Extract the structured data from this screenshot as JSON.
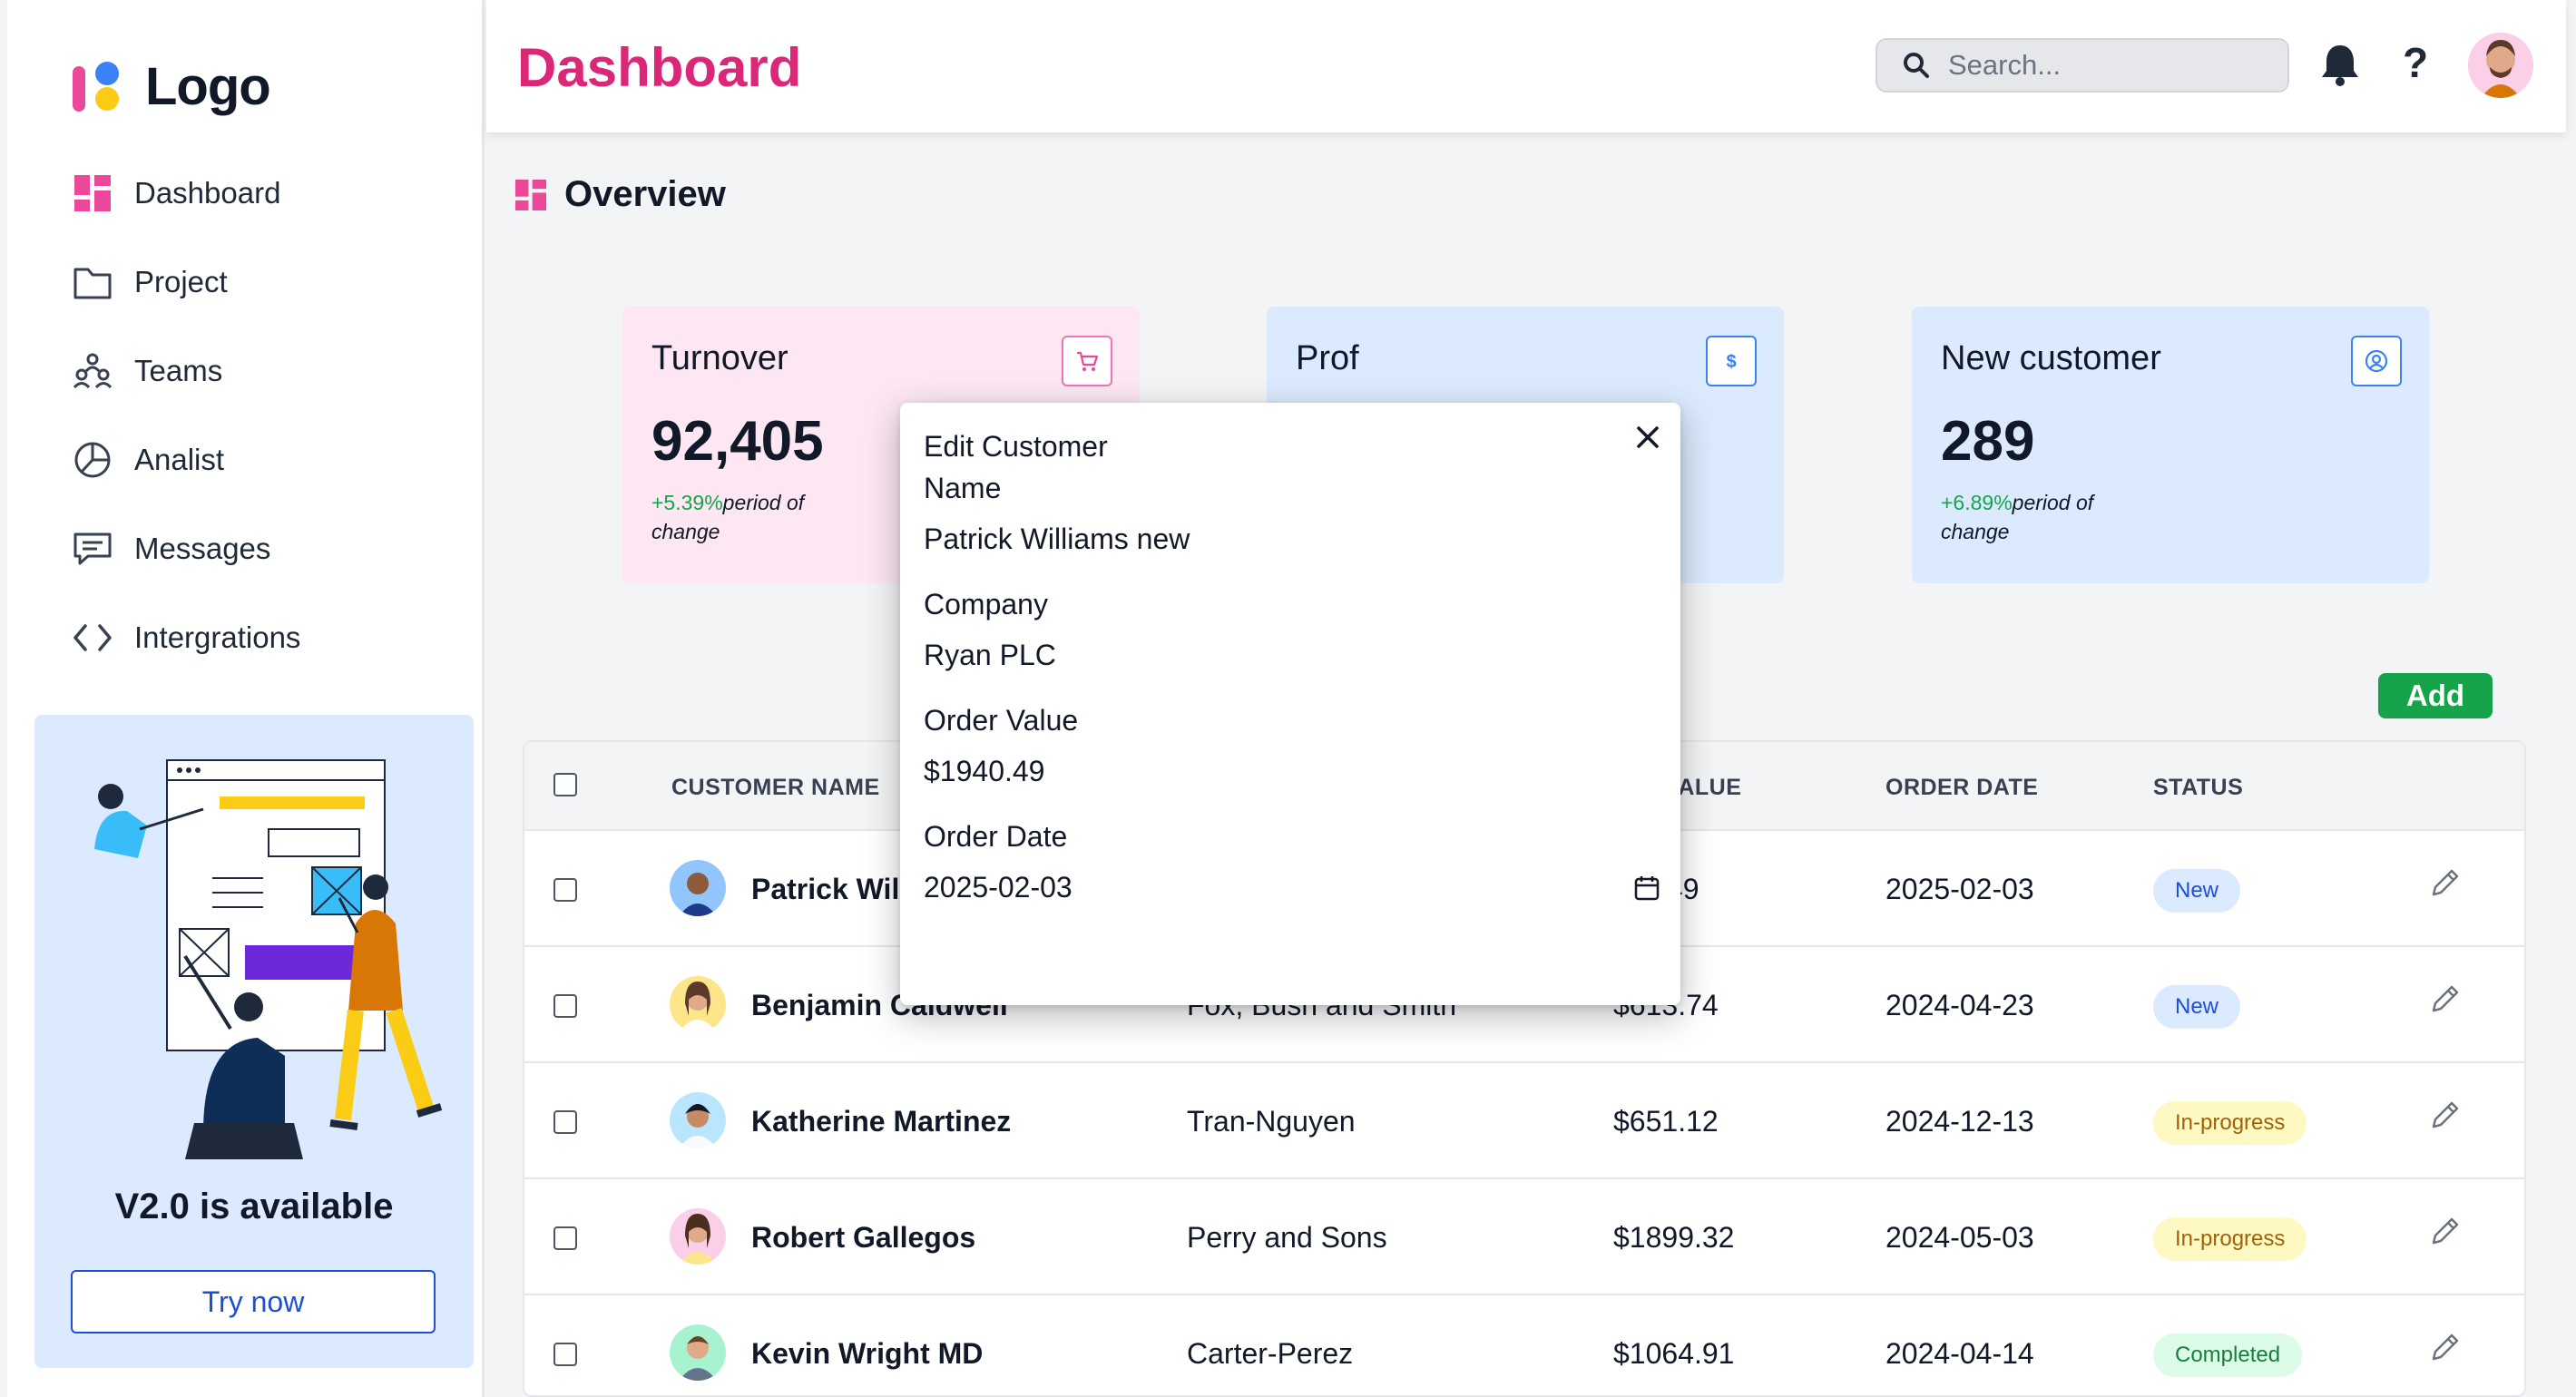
{
  "app": {
    "logo_text": "Logo",
    "page_title": "Dashboard"
  },
  "sidebar": {
    "items": [
      {
        "label": "Dashboard",
        "icon": "dashboard-grid-icon"
      },
      {
        "label": "Project",
        "icon": "folder-icon"
      },
      {
        "label": "Teams",
        "icon": "teams-icon"
      },
      {
        "label": "Analist",
        "icon": "pie-chart-icon"
      },
      {
        "label": "Messages",
        "icon": "message-icon"
      },
      {
        "label": "Intergrations",
        "icon": "code-icon"
      }
    ],
    "promo": {
      "title": "V2.0 is available",
      "button": "Try now"
    }
  },
  "header": {
    "search_placeholder": "Search...",
    "help_label": "?"
  },
  "overview": {
    "title": "Overview",
    "stats": [
      {
        "title": "Turnover",
        "value": "92,405",
        "change": "+5.39%",
        "change_note": "period of change",
        "icon": "cart-icon"
      },
      {
        "title": "Prof",
        "value": "",
        "change": "",
        "change_note": "",
        "icon": "dollar-icon"
      },
      {
        "title": "New customer",
        "value": "289",
        "change": "+6.89%",
        "change_note": "period of change",
        "icon": "user-circle-icon"
      }
    ]
  },
  "table": {
    "add_button": "Add",
    "headers": {
      "customer_name": "CUSTOMER NAME",
      "order_value": "R VALUE",
      "order_date": "ORDER DATE",
      "status": "STATUS"
    },
    "rows": [
      {
        "name": "Patrick Willi",
        "company": "",
        "value": ".49",
        "date": "2025-02-03",
        "status": "New"
      },
      {
        "name": "Benjamin Caldwell",
        "company": "Fox, Bush and Smith",
        "value": "$613.74",
        "date": "2024-04-23",
        "status": "New"
      },
      {
        "name": "Katherine Martinez",
        "company": "Tran-Nguyen",
        "value": "$651.12",
        "date": "2024-12-13",
        "status": "In-progress"
      },
      {
        "name": "Robert Gallegos",
        "company": "Perry and Sons",
        "value": "$1899.32",
        "date": "2024-05-03",
        "status": "In-progress"
      },
      {
        "name": "Kevin Wright MD",
        "company": "Carter-Perez",
        "value": "$1064.91",
        "date": "2024-04-14",
        "status": "Completed"
      }
    ]
  },
  "modal": {
    "title_line1": "Edit Customer",
    "name_label": "Name",
    "name_value": "Patrick Williams new",
    "company_label": "Company",
    "company_value": "Ryan PLC",
    "order_value_label": "Order Value",
    "order_value_value": "$1940.49",
    "order_date_label": "Order Date",
    "order_date_value": "2025-02-03"
  },
  "colors": {
    "brand": "#db2777",
    "add_button": "#16a34a",
    "pink_card": "#fce7f3",
    "blue_card": "#dbeafe"
  }
}
